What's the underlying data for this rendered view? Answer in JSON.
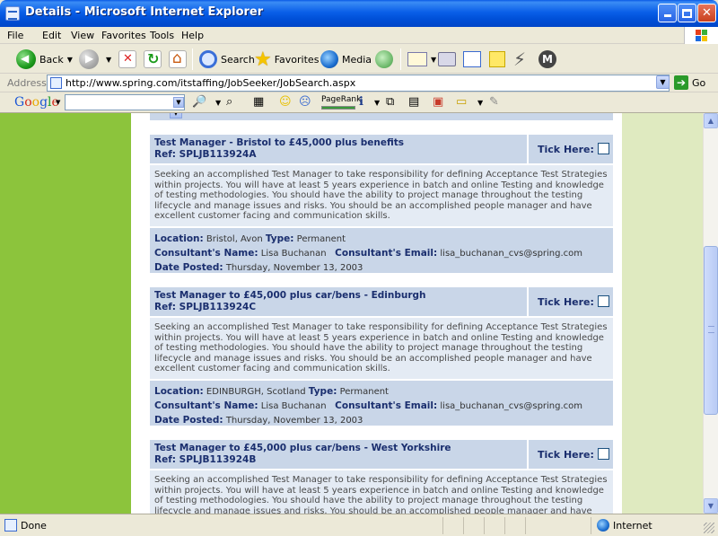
{
  "window": {
    "title": "Details - Microsoft Internet Explorer"
  },
  "menu": {
    "items": [
      "File",
      "Edit",
      "View",
      "Favorites",
      "Tools",
      "Help"
    ]
  },
  "toolbar": {
    "back": "Back",
    "search": "Search",
    "favorites": "Favorites",
    "media": "Media"
  },
  "address": {
    "label": "Address",
    "url": "http://www.spring.com/itstaffing/JobSeeker/JobSearch.aspx",
    "go": "Go"
  },
  "google": {
    "logo": "Google",
    "search_value": "",
    "pagerank": "PageRank"
  },
  "jobs": [
    {
      "title": "Test Manager - Bristol to £45,000 plus benefits",
      "ref": "Ref: SPLJB113924A",
      "tick_label": "Tick Here:",
      "description": "Seeking an accomplished Test Manager to take responsibility for defining Acceptance Test Strategies within projects. You will have at least 5 years experience in batch and online Testing and knowledge of testing methodologies. You should have the ability to project manage throughout the testing lifecycle and manage issues and risks. You should be an accomplished people manager and have excellent customer facing and communication skills.",
      "location_label": "Location:",
      "location": "Bristol, Avon",
      "type_label": "Type:",
      "type": "Permanent",
      "consultant_label": "Consultant's Name:",
      "consultant": "Lisa Buchanan",
      "email_label": "Consultant's Email:",
      "email": "lisa_buchanan_cvs@spring.com",
      "date_label": "Date Posted:",
      "date": "Thursday, November 13, 2003"
    },
    {
      "title": "Test Manager to £45,000 plus car/bens - Edinburgh",
      "ref": "Ref: SPLJB113924C",
      "tick_label": "Tick Here:",
      "description": "Seeking an accomplished Test Manager to take responsibility for defining Acceptance Test Strategies within projects. You will have at least 5 years experience in batch and online Testing and knowledge of testing methodologies. You should have the ability to project manage throughout the testing lifecycle and manage issues and risks. You should be an accomplished people manager and have excellent customer facing and communication skills.",
      "location_label": "Location:",
      "location": "EDINBURGH, Scotland",
      "type_label": "Type:",
      "type": "Permanent",
      "consultant_label": "Consultant's Name:",
      "consultant": "Lisa Buchanan",
      "email_label": "Consultant's Email:",
      "email": "lisa_buchanan_cvs@spring.com",
      "date_label": "Date Posted:",
      "date": "Thursday, November 13, 2003"
    },
    {
      "title": "Test Manager to £45,000 plus car/bens - West Yorkshire",
      "ref": "Ref: SPLJB113924B",
      "tick_label": "Tick Here:",
      "description": "Seeking an accomplished Test Manager to take responsibility for defining Acceptance Test Strategies within projects. You will have at least 5 years experience in batch and online Testing and knowledge of testing methodologies. You should have the ability to project manage throughout the testing lifecycle and manage issues and risks. You should be an accomplished people manager and have excellent customer facing and communication skills."
    }
  ],
  "status": {
    "text": "Done",
    "zone": "Internet"
  }
}
